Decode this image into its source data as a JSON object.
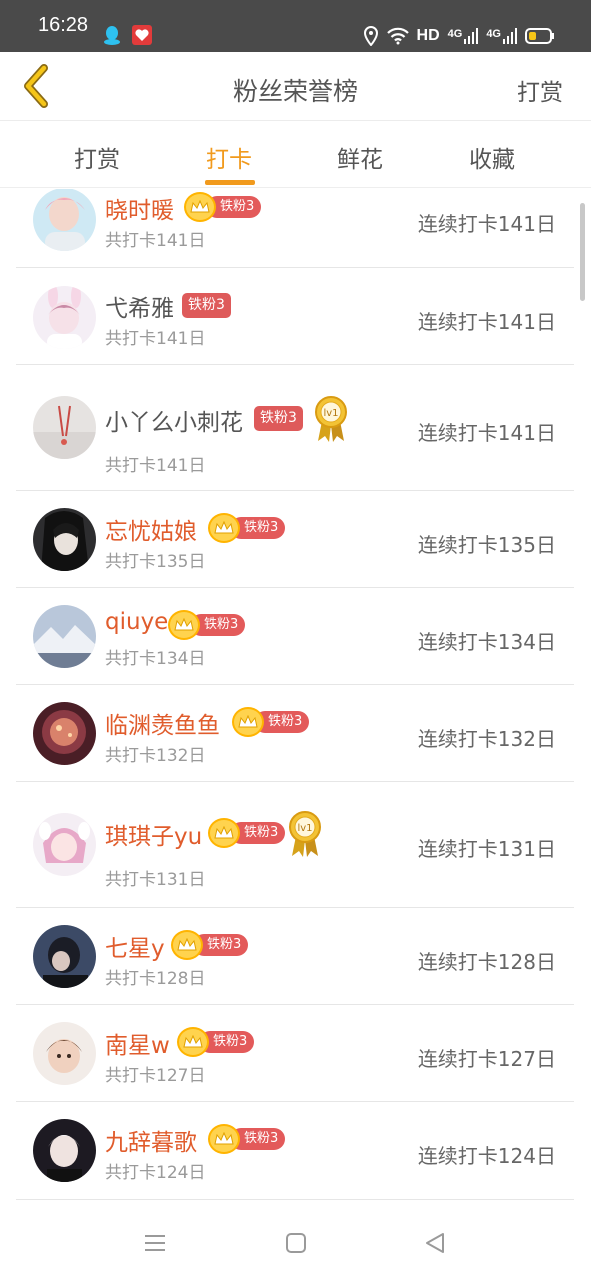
{
  "status_bar": {
    "time": "16:28",
    "network_label": "HD",
    "signal_1": "4G",
    "signal_2": "4G",
    "icons": [
      "qq-icon",
      "app-heart-icon",
      "location-icon",
      "wifi-icon",
      "signal-icon",
      "battery-icon"
    ]
  },
  "header": {
    "back_icon": "chevron-left-icon",
    "title": "粉丝荣誉榜",
    "action_label": "打赏"
  },
  "tabs": [
    {
      "label": "打赏",
      "active": false
    },
    {
      "label": "打卡",
      "active": true
    },
    {
      "label": "鲜花",
      "active": false
    },
    {
      "label": "收藏",
      "active": false
    }
  ],
  "rows": [
    {
      "name": "晓时暖",
      "badge": "铁粉3",
      "badge_style": "crown",
      "sub": "共打卡141日",
      "streak": "连续打卡141日",
      "medal": null
    },
    {
      "name": "弋希雅",
      "badge": "铁粉3",
      "badge_style": "rect",
      "sub": "共打卡141日",
      "streak": "连续打卡141日",
      "medal": null
    },
    {
      "name": "小丫么小刺花",
      "badge": "铁粉3",
      "badge_style": "rect",
      "sub": "共打卡141日",
      "streak": "连续打卡141日",
      "medal": "lv1"
    },
    {
      "name": "忘忧姑娘",
      "badge": "铁粉3",
      "badge_style": "crown",
      "sub": "共打卡135日",
      "streak": "连续打卡135日",
      "medal": null
    },
    {
      "name": "qiuye",
      "badge": "铁粉3",
      "badge_style": "crown",
      "sub": "共打卡134日",
      "streak": "连续打卡134日",
      "medal": null
    },
    {
      "name": "临渊羡鱼鱼",
      "badge": "铁粉3",
      "badge_style": "crown",
      "sub": "共打卡132日",
      "streak": "连续打卡132日",
      "medal": null
    },
    {
      "name": "琪琪子yu",
      "badge": "铁粉3",
      "badge_style": "crown",
      "sub": "共打卡131日",
      "streak": "连续打卡131日",
      "medal": "lv1"
    },
    {
      "name": "七星y",
      "badge": "铁粉3",
      "badge_style": "crown",
      "sub": "共打卡128日",
      "streak": "连续打卡128日",
      "medal": null
    },
    {
      "name": "南星w",
      "badge": "铁粉3",
      "badge_style": "crown",
      "sub": "共打卡127日",
      "streak": "连续打卡127日",
      "medal": null
    },
    {
      "name": "九辞暮歌",
      "badge": "铁粉3",
      "badge_style": "crown",
      "sub": "共打卡124日",
      "streak": "连续打卡124日",
      "medal": null
    }
  ],
  "nav_bar": {
    "icons": [
      "menu-icon",
      "home-square-icon",
      "back-triangle-icon"
    ]
  },
  "colors": {
    "accent": "#f19a1d",
    "name_highlight": "#e05c2c",
    "badge_red": "#e35a5a",
    "crown_gold": "#ffd34e"
  }
}
